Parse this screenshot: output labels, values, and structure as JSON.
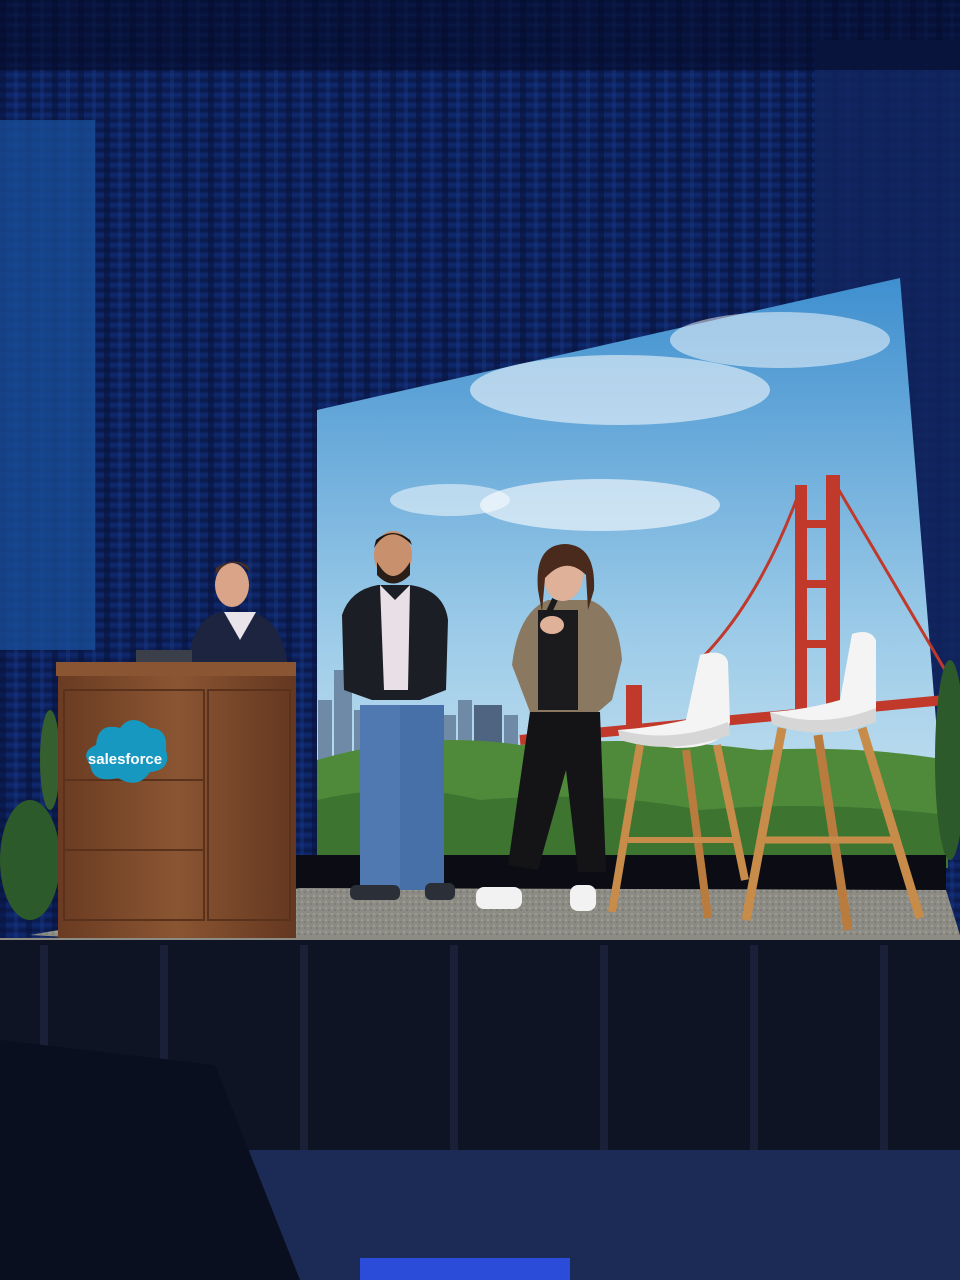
{
  "podium": {
    "logo_text": "salesforce",
    "logo_color": "#1798c1"
  },
  "colors": {
    "curtain": "#0d2a73",
    "sky": "#8fc3e6",
    "bridge": "#c0392b",
    "podium_wood": "#7a4a2c",
    "stage_carpet": "#8f8f86"
  }
}
